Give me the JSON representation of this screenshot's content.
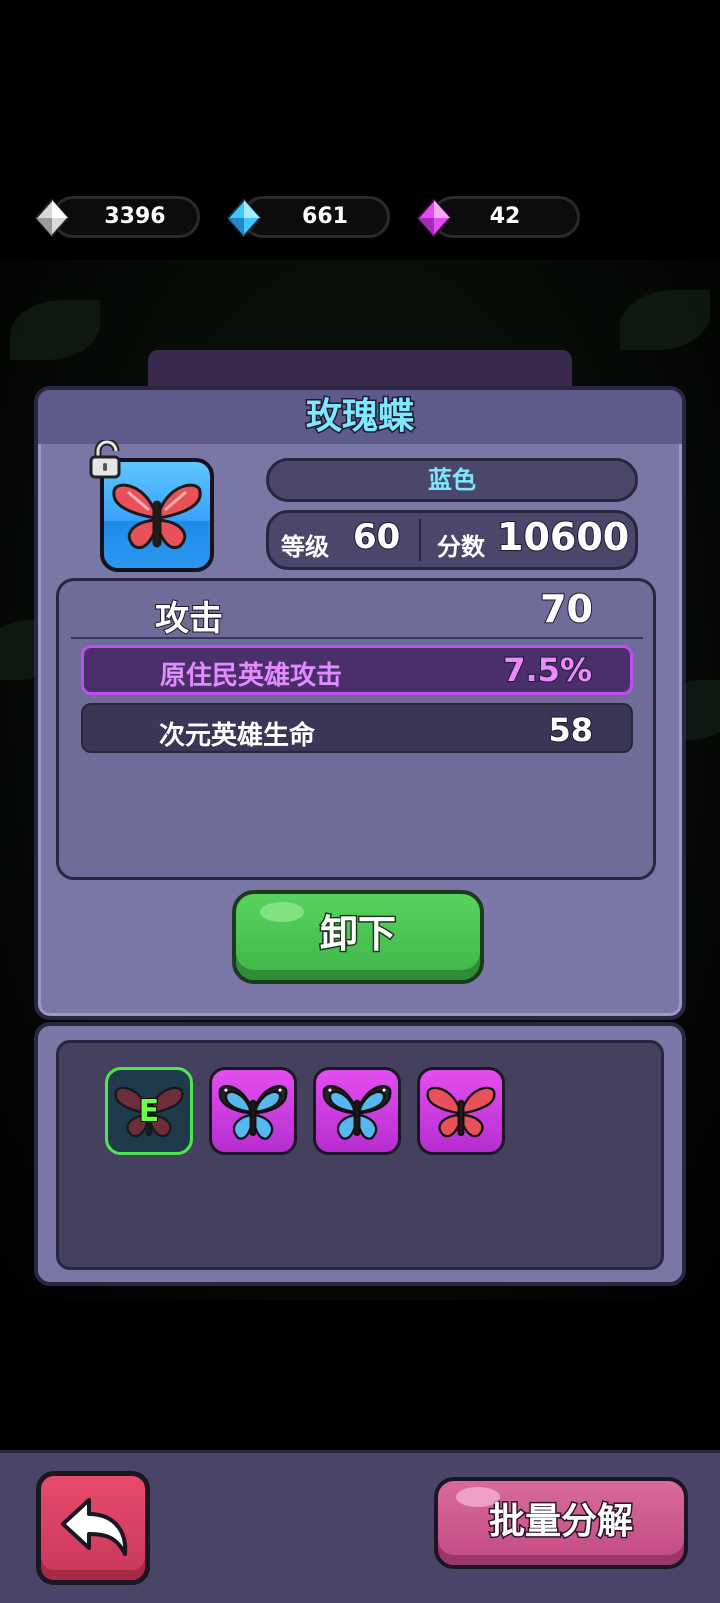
{
  "currencies": [
    {
      "name": "white-diamond",
      "value": "3396",
      "color": "#e6e6e6"
    },
    {
      "name": "blue-diamond",
      "value": "661",
      "color": "#3fc8ff"
    },
    {
      "name": "purple-diamond",
      "value": "42",
      "color": "#e24df0"
    }
  ],
  "item": {
    "name": "玫瑰蝶",
    "rarity": "蓝色",
    "level_label": "等级",
    "level": "60",
    "score_label": "分数",
    "score": "10600",
    "main_stat": {
      "name": "攻击",
      "value": "70"
    },
    "sub_stats": [
      {
        "name": "原住民英雄攻击",
        "value": "7.5%",
        "highlight": true
      },
      {
        "name": "次元英雄生命",
        "value": "58",
        "highlight": false
      }
    ]
  },
  "actions": {
    "unequip": "卸下",
    "bulk_decompose": "批量分解"
  },
  "inventory": [
    {
      "kind": "red-butterfly",
      "equipped": true,
      "badge": "E",
      "frame": "equipped"
    },
    {
      "kind": "blue-butterfly",
      "equipped": false,
      "frame": "purple"
    },
    {
      "kind": "blue-butterfly",
      "equipped": false,
      "frame": "purple"
    },
    {
      "kind": "red-butterfly",
      "equipped": false,
      "frame": "purple"
    }
  ],
  "colors": {
    "panel": "#7a77a6",
    "title": "#7fe8ff",
    "highlight_stat": "#e28cff",
    "unequip_button": "#4cc552",
    "bulk_button": "#d05a90",
    "back_button": "#d9405f"
  }
}
